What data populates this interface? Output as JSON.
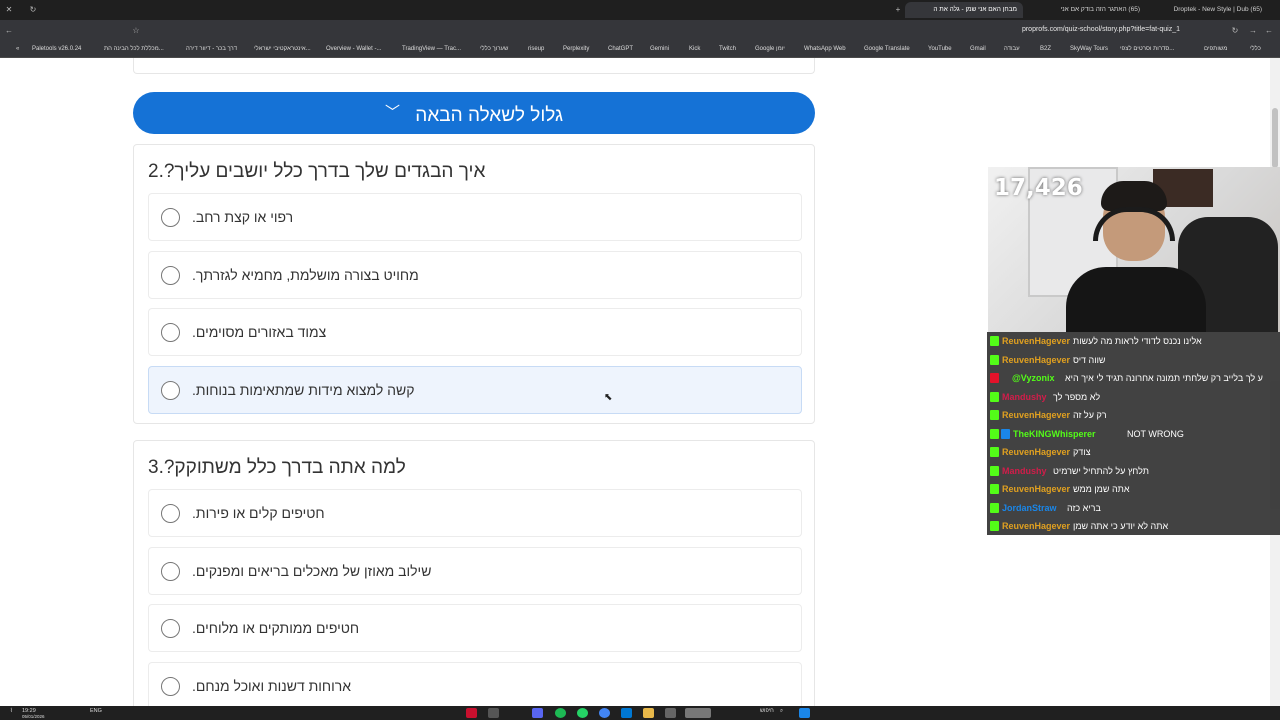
{
  "browser": {
    "tabs": [
      {
        "title": "(65) Droptek - New Style | Dub"
      },
      {
        "title": "(65) האתגר הזה בודק אם אני"
      },
      {
        "title": "מבחן האם אני שמן - גלה את ה"
      }
    ],
    "url": "proprofs.com/quiz-school/story.php?title=fat-quiz_1",
    "bookmarks": [
      "Paletools v26.0.24",
      "מכללת לכל הבינה הת...",
      "דרך בכר - דיוור דירה",
      "אינטראקטיבי ישראלי...",
      "Overview - Wallet -...",
      "TradingView — Trac...",
      "שערוך כללי",
      "riseup",
      "Perplexity",
      "ChatGPT",
      "Gemini",
      "Kick",
      "Twitch",
      "Google יומן",
      "WhatsApp Web",
      "Google Translate",
      "YouTube",
      "Gmail",
      "עבודה",
      "B2Z",
      "SkyWay Tours",
      "סדרות וסרטים לצפי...",
      "משותפים",
      "כללי"
    ]
  },
  "quiz": {
    "next_button": "גלול לשאלה הבאה",
    "questions": [
      {
        "title": "איך הבגדים שלך בדרך כלל יושבים עליך?.2",
        "options": [
          "רפוי או קצת רחב.",
          "מחויט בצורה מושלמת, מחמיא לגזרתך.",
          "צמוד באזורים מסוימים.",
          "קשה למצוא מידות שמתאימות בנוחות."
        ]
      },
      {
        "title": "למה אתה בדרך כלל משתוקק?.3",
        "options": [
          "חטיפים קלים או פירות.",
          "שילוב מאוזן של מאכלים בריאים ומפנקים.",
          "חטיפים ממותקים או מלוחים.",
          "ארוחות דשנות ואוכל מנחם."
        ]
      }
    ]
  },
  "stream": {
    "viewer_count": "17,426",
    "chat": [
      {
        "user": "ReuvenHagever",
        "color": "#e0a020",
        "text": "אלינו נכנס לדודי לראות מה לעשות"
      },
      {
        "user": "ReuvenHagever",
        "color": "#e0a020",
        "text": "שווה דיס"
      },
      {
        "user": "@Vyzonix",
        "color": "#53fc18",
        "text": "ע לך בלייב רק שלחתי תמונה אחרונה תגיד לי איך היא"
      },
      {
        "user": "Mandushy",
        "color": "#d11d4a",
        "text": "לא מספר לך"
      },
      {
        "user": "ReuvenHagever",
        "color": "#e0a020",
        "text": "רק על זה"
      },
      {
        "user": "TheKINGWhisperer",
        "color": "#53fc18",
        "text": "NOT WRONG"
      },
      {
        "user": "ReuvenHagever",
        "color": "#e0a020",
        "text": "צודק"
      },
      {
        "user": "Mandushy",
        "color": "#d11d4a",
        "text": "תלחץ על להתחיל ישרמיט"
      },
      {
        "user": "ReuvenHagever",
        "color": "#e0a020",
        "text": "אתה שמן ממש"
      },
      {
        "user": "JordanStraw",
        "color": "#1a86e8",
        "text": "בריא כזה"
      },
      {
        "user": "ReuvenHagever",
        "color": "#e0a020",
        "text": "אתה לא יודע כי אתה שמן"
      }
    ]
  },
  "taskbar": {
    "time": "19:29",
    "date": "05/01/2026",
    "lang": "ENG",
    "search": "חיפוש"
  }
}
